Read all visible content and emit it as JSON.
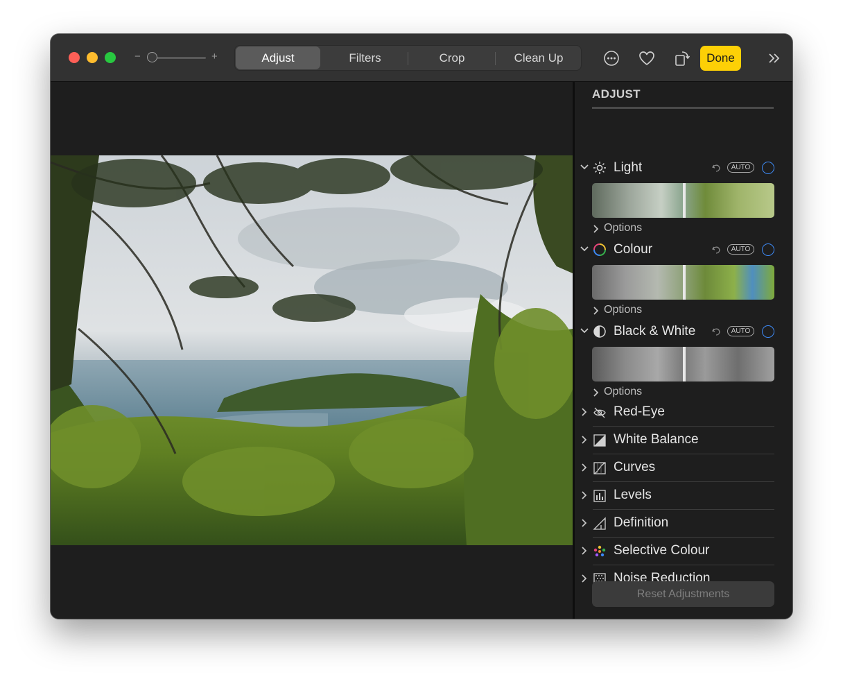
{
  "toolbar": {
    "zoom_minus": "−",
    "zoom_plus": "+",
    "tabs": [
      {
        "label": "Adjust",
        "active": true
      },
      {
        "label": "Filters",
        "active": false
      },
      {
        "label": "Crop",
        "active": false
      },
      {
        "label": "Clean Up",
        "active": false
      }
    ],
    "done_label": "Done",
    "icons": [
      "more-options-icon",
      "favorite-heart-icon",
      "rotate-icon",
      "expand-chevrons-icon"
    ],
    "accent_color": "#fdd006"
  },
  "sidebar": {
    "title": "ADJUST",
    "sections": [
      {
        "label": "Light",
        "icon": "sun-icon",
        "auto": "AUTO",
        "options": "Options"
      },
      {
        "label": "Colour",
        "icon": "colour-wheel-icon",
        "auto": "AUTO",
        "options": "Options"
      },
      {
        "label": "Black & White",
        "icon": "half-circle-icon",
        "auto": "AUTO",
        "options": "Options"
      }
    ],
    "tools": [
      {
        "label": "Red-Eye",
        "icon": "eye-slash-icon"
      },
      {
        "label": "White Balance",
        "icon": "white-balance-icon"
      },
      {
        "label": "Curves",
        "icon": "curves-icon"
      },
      {
        "label": "Levels",
        "icon": "levels-icon"
      },
      {
        "label": "Definition",
        "icon": "definition-triangle-icon"
      },
      {
        "label": "Selective Colour",
        "icon": "selective-colour-dots-icon"
      },
      {
        "label": "Noise Reduction",
        "icon": "noise-reduction-icon"
      }
    ],
    "reset_label": "Reset Adjustments",
    "toggle_color": "#3d88f2"
  }
}
